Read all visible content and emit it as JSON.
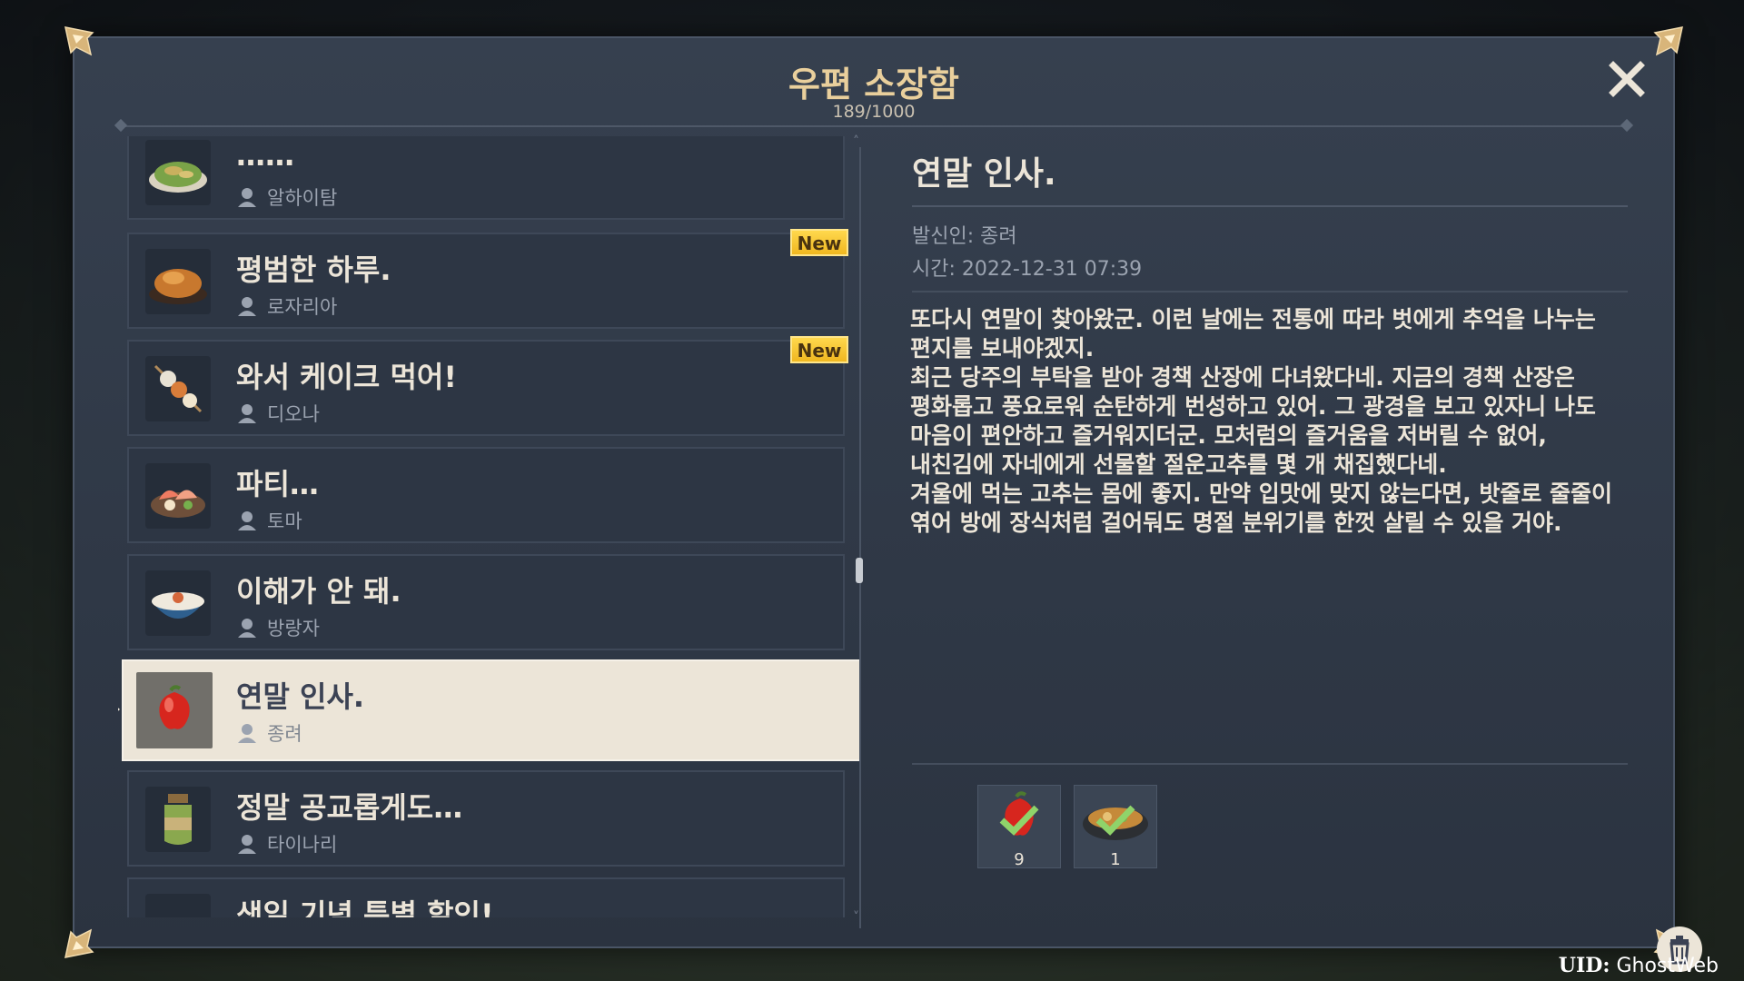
{
  "window": {
    "title": "우편 소장함",
    "count": "189/1000"
  },
  "mail_list": [
    {
      "subject": "……",
      "sender": "알하이탐",
      "icon": "food-dish-icon",
      "new": false
    },
    {
      "subject": "평범한 하루.",
      "sender": "로자리아",
      "icon": "roast-food-icon",
      "new": true,
      "new_label": "New"
    },
    {
      "subject": "와서 케이크 먹어!",
      "sender": "디오나",
      "icon": "skewer-food-icon",
      "new": true,
      "new_label": "New"
    },
    {
      "subject": "파티…",
      "sender": "토마",
      "icon": "sashimi-food-icon",
      "new": false
    },
    {
      "subject": "이해가 안 돼.",
      "sender": "방랑자",
      "icon": "rice-bowl-icon",
      "new": false
    },
    {
      "subject": "연말 인사.",
      "sender": "종려",
      "icon": "jueyun-chili-icon",
      "new": false,
      "selected": true
    },
    {
      "subject": "정말 공교롭게도…",
      "sender": "타이나리",
      "icon": "jar-icon",
      "new": false
    },
    {
      "subject": "생일 기념 특별 할인!",
      "sender": "",
      "icon": "seafood-icon",
      "new": false
    }
  ],
  "detail": {
    "subject": "연말 인사.",
    "sender": "발신인: 종려",
    "time": "시간: 2022-12-31 07:39",
    "body": [
      "또다시 연말이 찾아왔군. 이런 날에는 전통에 따라 벗에게 추억을 나누는",
      "편지를 보내야겠지.",
      "최근 당주의 부탁을 받아 경책 산장에 다녀왔다네. 지금의 경책 산장은",
      "평화롭고 풍요로워 순탄하게 번성하고 있어. 그 광경을 보고 있자니 나도",
      "마음이 편안하고 즐거워지더군. 모처럼의 즐거움을 저버릴 수 없어,",
      "내친김에 자네에게 선물할 절운고추를 몇 개 채집했다네.",
      "겨울에 먹는 고추는 몸에 좋지. 만약 입맛에 맞지 않는다면, 밧줄로 줄줄이",
      "엮어 방에 장식처럼 걸어둬도 명절 분위기를 한껏 살릴 수 있을 거야."
    ],
    "attachments": [
      {
        "icon": "jueyun-chili-icon",
        "quantity": "9",
        "claimed": true
      },
      {
        "icon": "stew-pot-icon",
        "quantity": "1",
        "claimed": true
      }
    ]
  },
  "footer": {
    "uid_label": "UID:",
    "uid_value": "GhostWeb"
  },
  "colors": {
    "panel": "#2f3846",
    "title_gold": "#e9cf9c",
    "selected_bg": "#ece5d8",
    "new_badge": "#f0b720"
  }
}
